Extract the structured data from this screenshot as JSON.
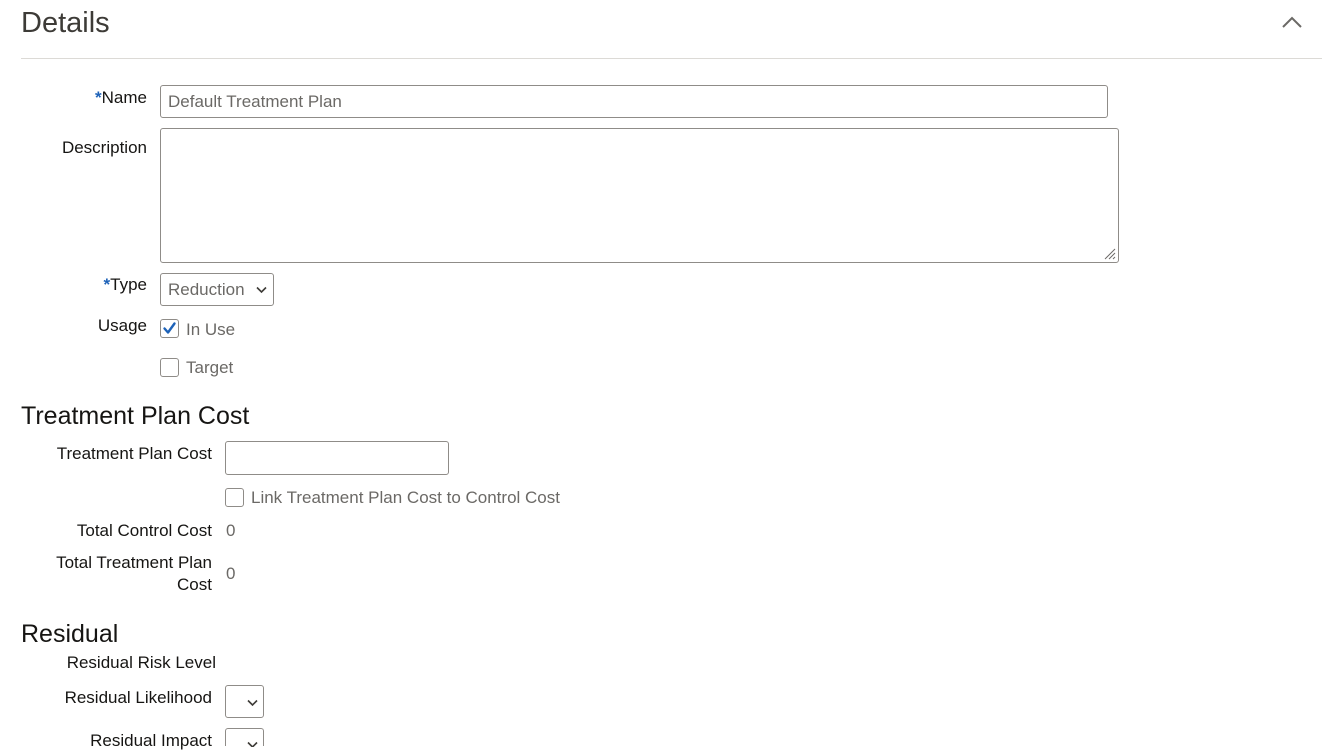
{
  "details": {
    "title": "Details",
    "fields": {
      "name": {
        "required_marker": "*",
        "label": "Name",
        "value": "Default Treatment Plan"
      },
      "description": {
        "label": "Description",
        "value": ""
      },
      "type": {
        "required_marker": "*",
        "label": "Type",
        "selected": "Reduction"
      },
      "usage": {
        "label": "Usage",
        "options": [
          {
            "label": "In Use",
            "checked": true
          },
          {
            "label": "Target",
            "checked": false
          }
        ]
      }
    }
  },
  "treatment_plan_cost": {
    "title": "Treatment Plan Cost",
    "cost_label": "Treatment Plan Cost",
    "cost_value": "",
    "link_label": "Link Treatment Plan Cost to Control Cost",
    "link_checked": false,
    "total_control_cost_label": "Total Control Cost",
    "total_control_cost_value": "0",
    "total_treatment_plan_cost_label_line1": "Total Treatment Plan",
    "total_treatment_plan_cost_label_line2": "Cost",
    "total_treatment_plan_cost_value": "0"
  },
  "residual": {
    "title": "Residual",
    "risk_level_label": "Residual Risk Level",
    "likelihood_label": "Residual Likelihood",
    "likelihood_selected": "",
    "impact_label": "Residual Impact",
    "impact_selected": ""
  },
  "colors": {
    "accent": "#1d62b8",
    "text": "#161513",
    "muted_text": "#6b6966",
    "border": "#8f8c88"
  },
  "icons": {
    "collapse": "chevron-up-icon",
    "select": "chevron-down-icon",
    "check": "checkmark-icon",
    "resize": "resize-grip-icon"
  }
}
